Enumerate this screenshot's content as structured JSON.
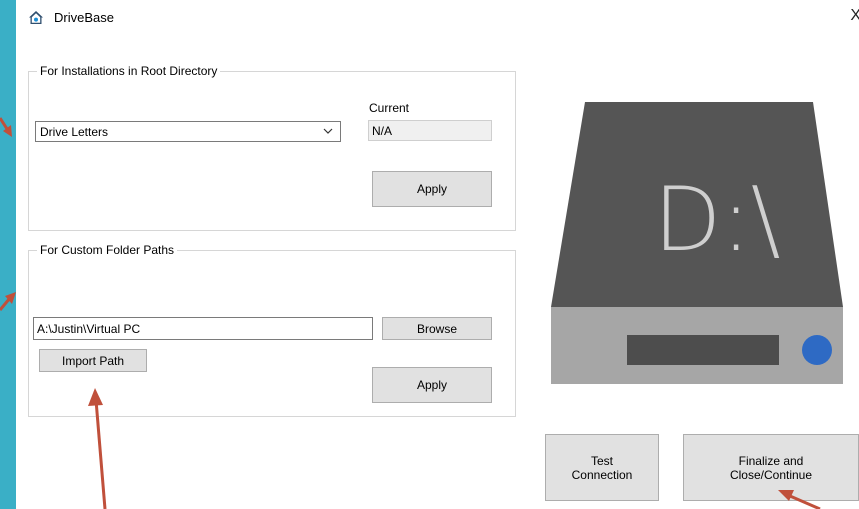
{
  "window": {
    "title": "DriveBase",
    "close_glyph": "X"
  },
  "root_group": {
    "legend": "For Installations in Root Directory",
    "dropdown_value": "Drive Letters",
    "current_label": "Current",
    "current_value": "N/A",
    "apply_label": "Apply"
  },
  "custom_group": {
    "legend": "For Custom Folder Paths",
    "path_value": "A:\\Justin\\Virtual PC",
    "browse_label": "Browse",
    "import_label": "Import Path",
    "apply_label": "Apply"
  },
  "drive_graphic": {
    "text": "D:\\",
    "body_color": "#555555",
    "bottom_color": "#a6a6a6",
    "led_color": "#2e6ac4"
  },
  "actions": {
    "test_label_1": "Test",
    "test_label_2": "Connection",
    "finalize_label_1": "Finalize and",
    "finalize_label_2": "Close/Continue"
  },
  "icons": {
    "app": "house-icon",
    "dropdown": "chevron-down-icon"
  },
  "colors": {
    "background": "#3aafc6",
    "annotation_arrow": "#c0503b"
  }
}
